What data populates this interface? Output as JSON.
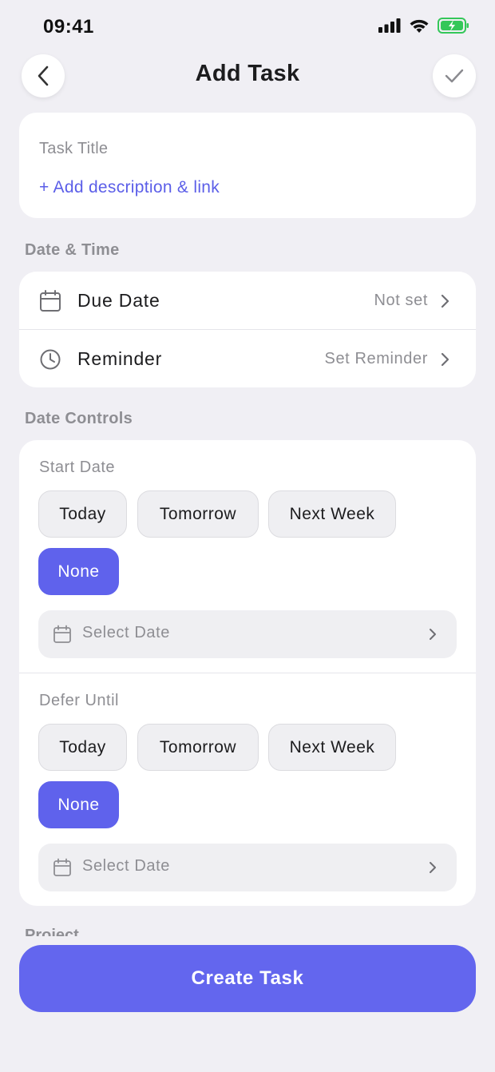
{
  "status_bar": {
    "time": "09:41"
  },
  "header": {
    "title": "Add Task"
  },
  "task": {
    "title_placeholder": "Task Title",
    "add_description_label": "+ Add description & link"
  },
  "date_time": {
    "section_label": "Date & Time",
    "due_date": {
      "label": "Due Date",
      "value": "Not set"
    },
    "reminder": {
      "label": "Reminder",
      "value": "Set Reminder"
    }
  },
  "date_controls": {
    "section_label": "Date Controls",
    "start": {
      "label": "Start Date",
      "options": [
        "Today",
        "Tomorrow",
        "Next Week",
        "None"
      ],
      "selected": "None",
      "select_date_placeholder": "Select Date"
    },
    "defer": {
      "label": "Defer Until",
      "options": [
        "Today",
        "Tomorrow",
        "Next Week",
        "None"
      ],
      "selected": "None",
      "select_date_placeholder": "Select Date"
    }
  },
  "project": {
    "section_label": "Project"
  },
  "footer": {
    "create_button_label": "Create Task"
  },
  "colors": {
    "accent": "#5f62ec",
    "background": "#f0eff4",
    "muted_text": "#8e8e93"
  }
}
